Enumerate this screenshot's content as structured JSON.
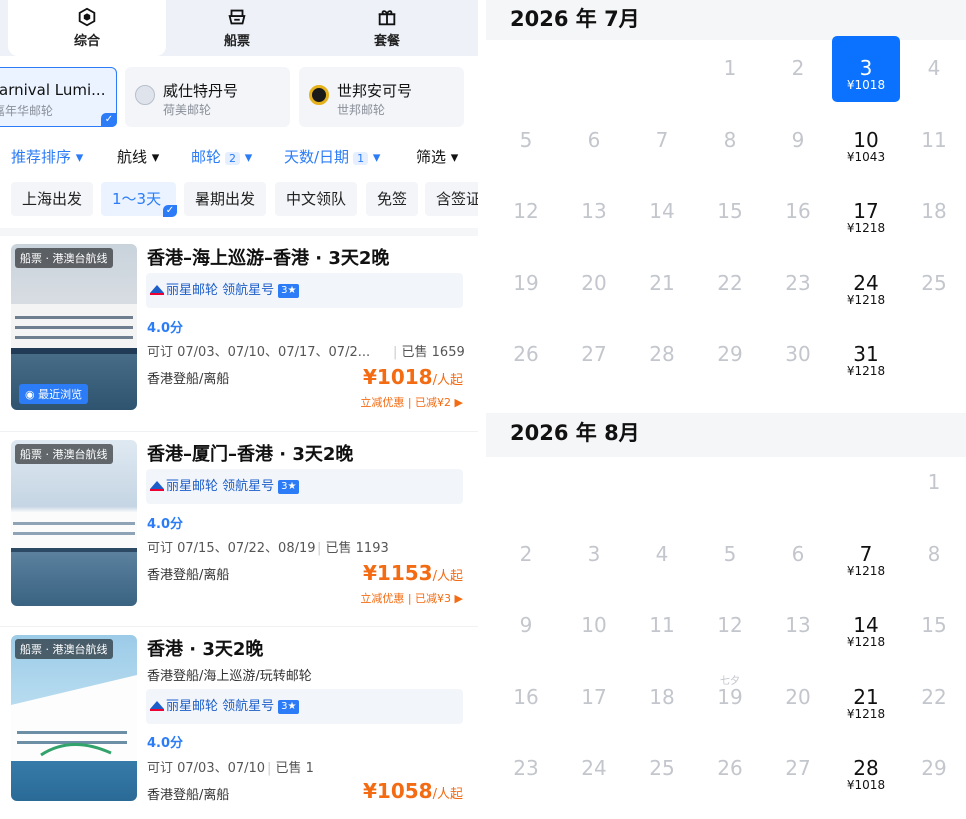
{
  "tabs": [
    {
      "label": "综合",
      "icon": "cube-icon"
    },
    {
      "label": "船票",
      "icon": "ticket-icon"
    },
    {
      "label": "套餐",
      "icon": "gift-icon"
    }
  ],
  "ships": [
    {
      "name": "arnival Lumi...",
      "sub": "嘉年华邮轮",
      "selected": true
    },
    {
      "name": "威仕特丹号",
      "sub": "荷美邮轮"
    },
    {
      "name": "世邦安可号",
      "sub": "世邦邮轮"
    }
  ],
  "filters": {
    "sort": "推荐排序 ▾",
    "route": "航线 ▾",
    "ship": "邮轮",
    "ship_count": "2",
    "ship_arrow": "▾",
    "days": "天数/日期",
    "days_count": "1",
    "days_arrow": "▾",
    "screen": "筛选 ▾"
  },
  "tags": [
    "上海出发",
    "1～3天",
    "暑期出发",
    "中文领队",
    "免签",
    "含签证"
  ],
  "cards": [
    {
      "badge": "船票 · 港澳台航线",
      "recent": "最近浏览",
      "title": "香港–海上巡游–香港 · 3天2晚",
      "brand": "丽星邮轮 领航星号",
      "star": "3★",
      "score": "4.0分",
      "avail": "可订 07/03、07/10、07/17、07/2...",
      "sold": "已售 1659",
      "port": "香港登船/离船",
      "price": "¥1018",
      "price_unit": "/人起",
      "promo": "立减优惠 | 已减¥2 ▶"
    },
    {
      "badge": "船票 · 港澳台航线",
      "title": "香港–厦门–香港 · 3天2晚",
      "brand": "丽星邮轮 领航星号",
      "star": "3★",
      "score": "4.0分",
      "avail": "可订 07/15、07/22、08/19",
      "sold": "已售 1193",
      "port": "香港登船/离船",
      "price": "¥1153",
      "price_unit": "/人起",
      "promo": "立减优惠 | 已减¥3 ▶"
    },
    {
      "badge": "船票 · 港澳台航线",
      "title": "香港 · 3天2晚",
      "subline": "香港登船/海上巡游/玩转邮轮",
      "brand": "丽星邮轮 领航星号",
      "star": "3★",
      "score": "4.0分",
      "avail": "可订 07/03、07/10",
      "sold": "已售 1",
      "port": "香港登船/离船",
      "price": "¥1058",
      "price_unit": "/人起"
    }
  ],
  "calendar": {
    "july": {
      "title": "2026 年 7月",
      "weeks": [
        [
          null,
          null,
          null,
          {
            "d": "1"
          },
          {
            "d": "2"
          },
          {
            "d": "3",
            "p": "¥1018",
            "sel": true
          },
          {
            "d": "4"
          }
        ],
        [
          {
            "d": "5"
          },
          {
            "d": "6"
          },
          {
            "d": "7"
          },
          {
            "d": "8"
          },
          {
            "d": "9"
          },
          {
            "d": "10",
            "p": "¥1043"
          },
          {
            "d": "11"
          }
        ],
        [
          {
            "d": "12"
          },
          {
            "d": "13"
          },
          {
            "d": "14"
          },
          {
            "d": "15"
          },
          {
            "d": "16"
          },
          {
            "d": "17",
            "p": "¥1218"
          },
          {
            "d": "18"
          }
        ],
        [
          {
            "d": "19"
          },
          {
            "d": "20"
          },
          {
            "d": "21"
          },
          {
            "d": "22"
          },
          {
            "d": "23"
          },
          {
            "d": "24",
            "p": "¥1218"
          },
          {
            "d": "25"
          }
        ],
        [
          {
            "d": "26"
          },
          {
            "d": "27"
          },
          {
            "d": "28"
          },
          {
            "d": "29"
          },
          {
            "d": "30"
          },
          {
            "d": "31",
            "p": "¥1218"
          },
          null
        ]
      ]
    },
    "august": {
      "title": "2026 年 8月",
      "weeks": [
        [
          null,
          null,
          null,
          null,
          null,
          null,
          {
            "d": "1"
          }
        ],
        [
          {
            "d": "2"
          },
          {
            "d": "3"
          },
          {
            "d": "4"
          },
          {
            "d": "5"
          },
          {
            "d": "6"
          },
          {
            "d": "7",
            "p": "¥1218"
          },
          {
            "d": "8"
          }
        ],
        [
          {
            "d": "9"
          },
          {
            "d": "10"
          },
          {
            "d": "11"
          },
          {
            "d": "12"
          },
          {
            "d": "13"
          },
          {
            "d": "14",
            "p": "¥1218"
          },
          {
            "d": "15"
          }
        ],
        [
          {
            "d": "16"
          },
          {
            "d": "17"
          },
          {
            "d": "18"
          },
          {
            "d": "19",
            "h": "七夕"
          },
          {
            "d": "20"
          },
          {
            "d": "21",
            "p": "¥1218"
          },
          {
            "d": "22"
          }
        ],
        [
          {
            "d": "23"
          },
          {
            "d": "24"
          },
          {
            "d": "25"
          },
          {
            "d": "26"
          },
          {
            "d": "27"
          },
          {
            "d": "28",
            "p": "¥1018"
          },
          {
            "d": "29"
          }
        ]
      ]
    }
  },
  "colors": {
    "accent": "#2b7cf6",
    "price": "#f36b12",
    "selected_day": "#0a72ff"
  }
}
